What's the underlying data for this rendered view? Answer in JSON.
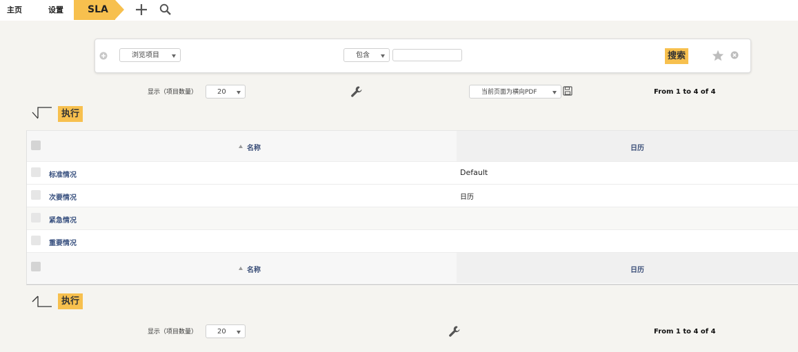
{
  "breadcrumb": {
    "home": "主页",
    "settings": "设置",
    "current": "SLA"
  },
  "toolbar": {
    "add_icon": "plus-icon",
    "search_icon": "search-icon"
  },
  "filter": {
    "field_select": "浏览项目",
    "operator_select": "包含",
    "value_input": "",
    "search_button": "搜索",
    "add_icon": "plus-circle-icon",
    "favorite_icon": "star-icon",
    "clear_icon": "close-circle-icon"
  },
  "list_controls_top": {
    "per_page_label": "显示（项目数量）",
    "per_page_value": "20",
    "tools_icon": "wrench-icon",
    "export_select": "当前页面为横向PDF",
    "save_icon": "save-icon",
    "pager": "From 1 to 4 of 4"
  },
  "actions": {
    "execute_top": "执行",
    "execute_bottom": "执行"
  },
  "table": {
    "columns": [
      "名称",
      "日历"
    ],
    "rows": [
      {
        "name": "标准情况",
        "calendar": "Default"
      },
      {
        "name": "次要情况",
        "calendar": "日历"
      },
      {
        "name": "紧急情况",
        "calendar": ""
      },
      {
        "name": "重要情况",
        "calendar": ""
      }
    ]
  },
  "list_controls_bottom": {
    "per_page_label": "显示（项目数量）",
    "per_page_value": "20",
    "tools_icon": "wrench-icon",
    "pager": "From 1 to 4 of 4"
  },
  "colors": {
    "accent": "#f7c04e",
    "link": "#3a5280",
    "background": "#f5f4f0"
  }
}
